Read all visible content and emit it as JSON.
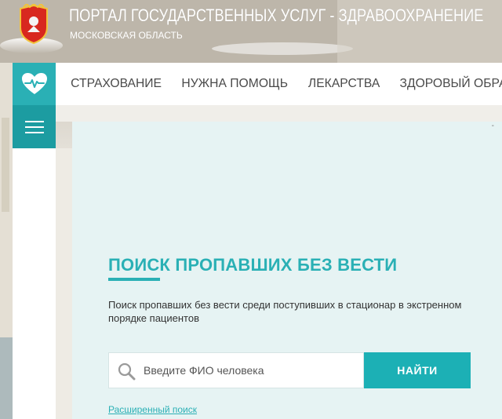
{
  "header": {
    "title": "ПОРТАЛ ГОСУДАРСТВЕННЫХ УСЛУГ - ЗДРАВООХРАНЕНИЕ",
    "subtitle": "МОСКОВСКАЯ ОБЛАСТЬ"
  },
  "nav": {
    "home_icon": "heart-pulse-icon",
    "menu_icon": "hamburger-icon",
    "items": [
      {
        "label": "СТРАХОВАНИЕ"
      },
      {
        "label": "НУЖНА ПОМОЩЬ"
      },
      {
        "label": "ЛЕКАРСТВА"
      },
      {
        "label": "ЗДОРОВЫЙ ОБРАЗ"
      }
    ]
  },
  "main": {
    "dash": "-",
    "title": "ПОИСК ПРОПАВШИХ БЕЗ ВЕСТИ",
    "description": "Поиск пропавших без вести среди поступивших в стационар в экстренном порядке пациентов",
    "search": {
      "placeholder": "Введите ФИО человека",
      "value": "",
      "button_label": "НАЙТИ"
    },
    "advanced_link": "Расширенный поиск"
  },
  "colors": {
    "accent": "#2ab0b5",
    "accent_dark": "#1c9ca1",
    "panel_bg": "#e6f3f3",
    "nav_text": "#4a4a4a"
  }
}
